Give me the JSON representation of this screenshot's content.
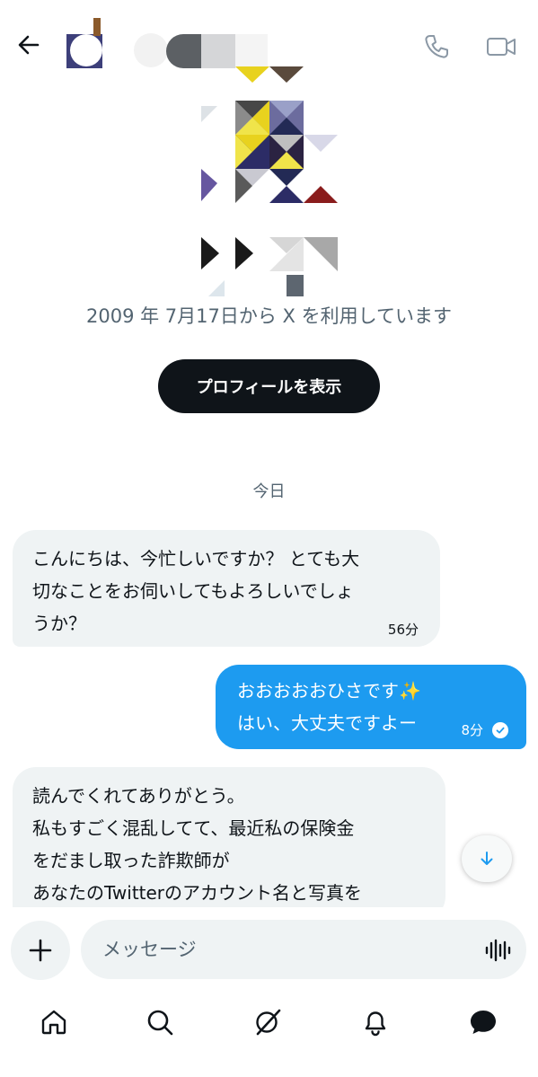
{
  "header": {
    "back_icon": "arrow-left-icon",
    "call_icon": "phone-icon",
    "video_icon": "video-camera-icon"
  },
  "profile": {
    "joined_text": "2009 年 7月17日から X を利用しています",
    "view_profile_label": "プロフィールを表示"
  },
  "conversation": {
    "day_separator": "今日",
    "messages": [
      {
        "direction": "incoming",
        "lines": [
          "こんにちは、今忙しいですか？ とても大",
          "切なことをお伺いしてもよろしいでしょ",
          "うか？"
        ],
        "time": "56分"
      },
      {
        "direction": "outgoing",
        "lines": [
          "おおおおおひさです✨",
          "はい、大丈夫ですよー"
        ],
        "time": "8分",
        "status_icon": "read-check-icon"
      },
      {
        "direction": "incoming",
        "lines": [
          "読んでくれてありがとう。",
          "私もすごく混乱してて、最近私の保険金",
          "をだまし取った詐欺師が",
          "あなたのTwitterのアカウント名と写真を"
        ]
      }
    ]
  },
  "composer": {
    "add_icon": "plus-icon",
    "placeholder": "メッセージ",
    "voice_icon": "voice-waveform-icon"
  },
  "bottom_nav": {
    "items": [
      "home-icon",
      "search-icon",
      "grok-icon",
      "notifications-icon",
      "messages-icon"
    ]
  },
  "colors": {
    "accent": "#1d9bf0",
    "incoming_bubble": "#eff3f4",
    "text_primary": "#0f1419",
    "text_secondary": "#536471"
  }
}
